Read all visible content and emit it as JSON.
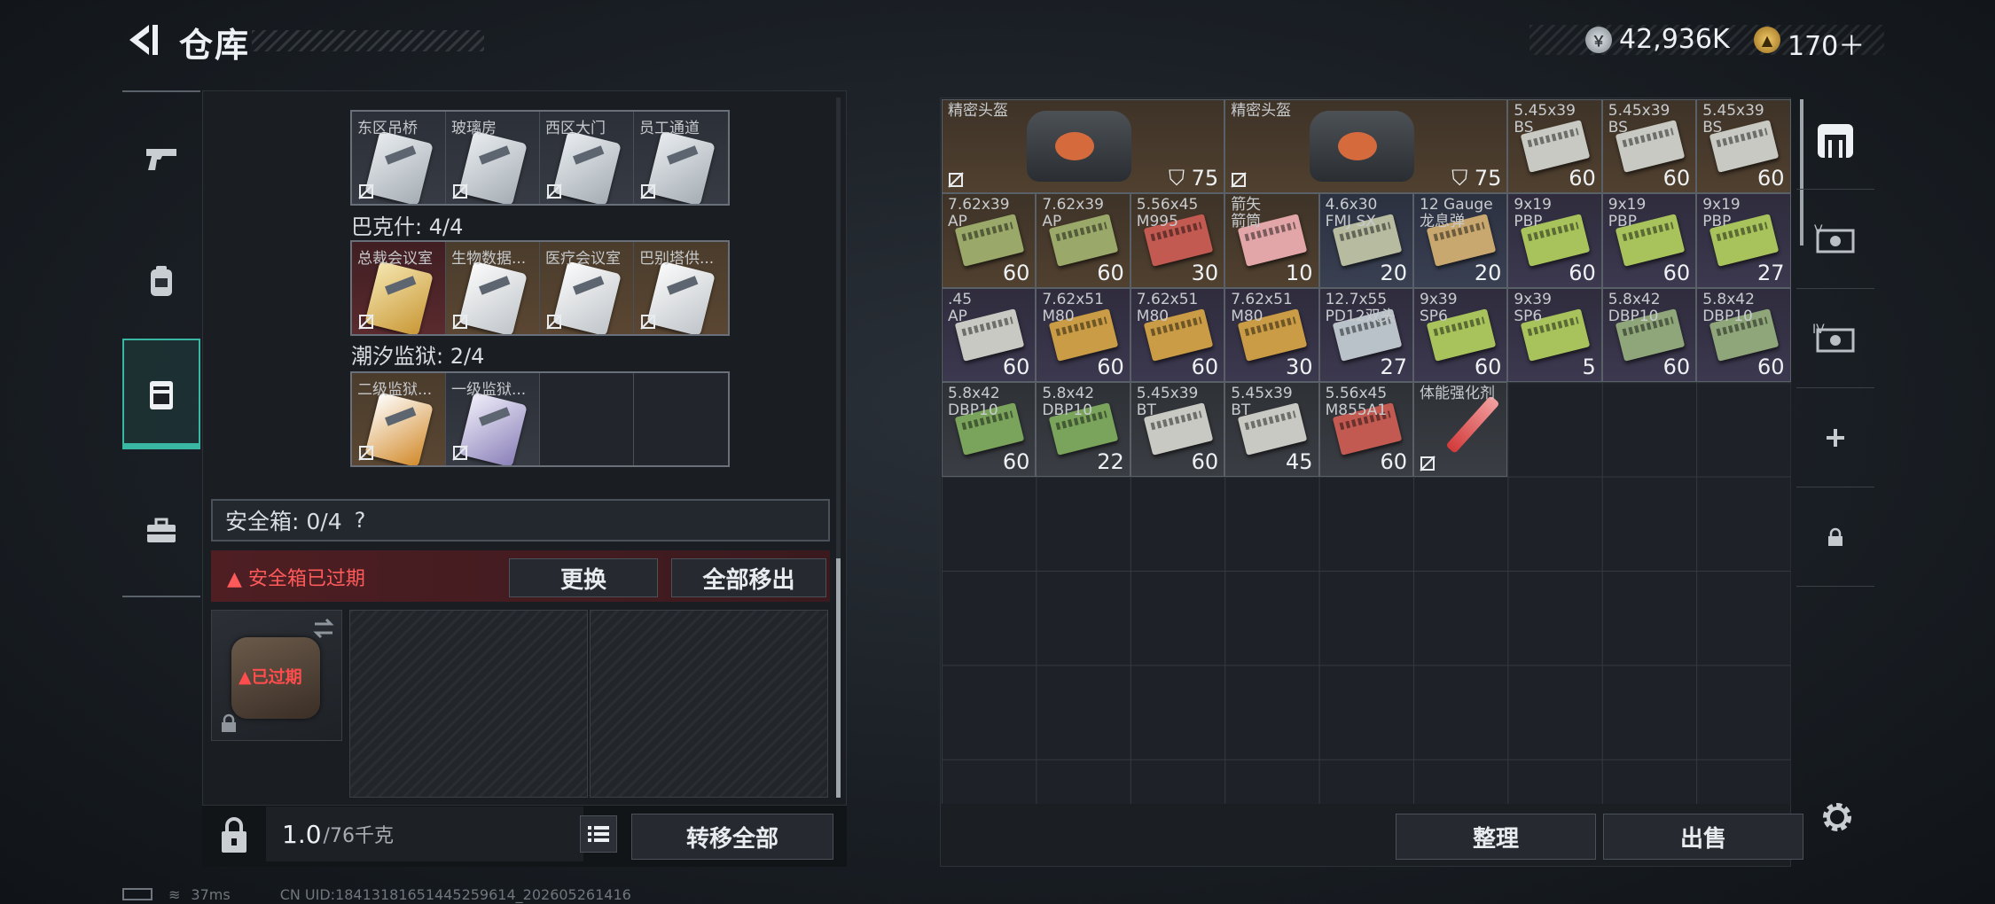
{
  "header": {
    "title": "仓库",
    "version": "",
    "currency": [
      {
        "name": "silver-coin-icon",
        "value": "42,936K"
      },
      {
        "name": "gold-coin-icon",
        "value": "170＋"
      }
    ]
  },
  "left_rail": {
    "items": [
      "pistol-icon",
      "backpack-icon",
      "locker-icon",
      "toolbox-icon"
    ],
    "active": "locker-icon"
  },
  "key_sections": [
    {
      "title": "",
      "cards": [
        {
          "label": "东区吊桥",
          "rarity": "plain"
        },
        {
          "label": "玻璃房",
          "rarity": "plain"
        },
        {
          "label": "西区大门",
          "rarity": "plain"
        },
        {
          "label": "员工通道",
          "rarity": "plain"
        }
      ]
    },
    {
      "title": "巴克什: 4/4",
      "cards": [
        {
          "label": "总裁会议室",
          "rarity": "red"
        },
        {
          "label": "生物数据...",
          "rarity": "gold"
        },
        {
          "label": "医疗会议室",
          "rarity": "gold"
        },
        {
          "label": "巴别塔供...",
          "rarity": "gold"
        }
      ]
    },
    {
      "title": "潮汐监狱: 2/4",
      "cards": [
        {
          "label": "二级监狱...",
          "rarity": "gold"
        },
        {
          "label": "一级监狱...",
          "rarity": "plain"
        },
        {
          "label": "",
          "rarity": "empty"
        },
        {
          "label": "",
          "rarity": "empty"
        }
      ]
    }
  ],
  "safe_box": {
    "label": "安全箱: 0/4",
    "help": "?",
    "expired_msg": "▲ 安全箱已过期",
    "replace_btn": "更换",
    "remove_all_btn": "全部移出",
    "case_status": "▲已过期"
  },
  "footer_left": {
    "weight": "1.0",
    "unit": "/76千克",
    "transfer_btn": "转移全部"
  },
  "stash": {
    "sort_btn": "整理",
    "sell_btn": "出售",
    "items": [
      {
        "name": "精密头盔",
        "count": "75",
        "kind": "helmet",
        "rarity": "gold",
        "col": 0,
        "row": 0,
        "w": 3,
        "h": 1,
        "armor": true
      },
      {
        "name": "精密头盔",
        "count": "75",
        "kind": "helmet",
        "rarity": "gold",
        "col": 3,
        "row": 0,
        "w": 3,
        "h": 1,
        "armor": true
      },
      {
        "name": "5.45x39\nBS",
        "count": "60",
        "kind": "ammo",
        "color": "#c8c9c2",
        "rarity": "gold",
        "col": 6,
        "row": 0
      },
      {
        "name": "5.45x39\nBS",
        "count": "60",
        "kind": "ammo",
        "color": "#c8c9c2",
        "rarity": "gold",
        "col": 7,
        "row": 0
      },
      {
        "name": "5.45x39\nBS",
        "count": "60",
        "kind": "ammo",
        "color": "#c8c9c2",
        "rarity": "gold",
        "col": 8,
        "row": 0
      },
      {
        "name": "7.62x39\nAP",
        "count": "60",
        "kind": "ammo",
        "color": "#9aa86a",
        "rarity": "gold",
        "col": 0,
        "row": 1
      },
      {
        "name": "7.62x39\nAP",
        "count": "60",
        "kind": "ammo",
        "color": "#9aa86a",
        "rarity": "gold",
        "col": 1,
        "row": 1
      },
      {
        "name": "5.56x45\nM995",
        "count": "30",
        "kind": "ammo",
        "color": "#c25a52",
        "rarity": "gold",
        "col": 2,
        "row": 1
      },
      {
        "name": "箭矢\n箭筒",
        "count": "10",
        "kind": "ammo",
        "color": "#e2a6a8",
        "rarity": "gold",
        "col": 3,
        "row": 1
      },
      {
        "name": "4.6x30\nFMJ SX",
        "count": "20",
        "kind": "ammo",
        "color": "#b7bba0",
        "rarity": "blue",
        "col": 4,
        "row": 1
      },
      {
        "name": "12 Gauge\n龙息弹",
        "count": "20",
        "kind": "ammo",
        "color": "#c9a870",
        "rarity": "blue",
        "col": 5,
        "row": 1
      },
      {
        "name": "9x19\nPBP",
        "count": "60",
        "kind": "ammo",
        "color": "#a8c35c",
        "rarity": "purple",
        "col": 6,
        "row": 1
      },
      {
        "name": "9x19\nPBP",
        "count": "60",
        "kind": "ammo",
        "color": "#a8c35c",
        "rarity": "purple",
        "col": 7,
        "row": 1
      },
      {
        "name": "9x19\nPBP",
        "count": "27",
        "kind": "ammo",
        "color": "#a8c35c",
        "rarity": "purple",
        "col": 8,
        "row": 1
      },
      {
        "name": ".45\nAP",
        "count": "60",
        "kind": "ammo",
        "color": "#c8c9c2",
        "rarity": "purple",
        "col": 0,
        "row": 2
      },
      {
        "name": "7.62x51\nM80",
        "count": "60",
        "kind": "ammo",
        "color": "#c99c45",
        "rarity": "purple",
        "col": 1,
        "row": 2
      },
      {
        "name": "7.62x51\nM80",
        "count": "60",
        "kind": "ammo",
        "color": "#c99c45",
        "rarity": "purple",
        "col": 2,
        "row": 2
      },
      {
        "name": "7.62x51\nM80",
        "count": "30",
        "kind": "ammo",
        "color": "#c99c45",
        "rarity": "purple",
        "col": 3,
        "row": 2
      },
      {
        "name": "12.7x55\nPD12双头",
        "count": "27",
        "kind": "ammo",
        "color": "#b9c2c8",
        "rarity": "purple",
        "col": 4,
        "row": 2
      },
      {
        "name": "9x39\nSP6",
        "count": "60",
        "kind": "ammo",
        "color": "#a8c35c",
        "rarity": "purple",
        "col": 5,
        "row": 2
      },
      {
        "name": "9x39\nSP6",
        "count": "5",
        "kind": "ammo",
        "color": "#a8c35c",
        "rarity": "purple",
        "col": 6,
        "row": 2
      },
      {
        "name": "5.8x42\nDBP10",
        "count": "60",
        "kind": "ammo",
        "color": "#8fa67a",
        "rarity": "purple",
        "col": 7,
        "row": 2
      },
      {
        "name": "5.8x42\nDBP10",
        "count": "60",
        "kind": "ammo",
        "color": "#8fa67a",
        "rarity": "purple",
        "col": 8,
        "row": 2
      },
      {
        "name": "5.8x42\nDBP10",
        "count": "60",
        "kind": "ammo",
        "color": "#7aa45c",
        "rarity": "white",
        "col": 0,
        "row": 3
      },
      {
        "name": "5.8x42\nDBP10",
        "count": "22",
        "kind": "ammo",
        "color": "#7aa45c",
        "rarity": "white",
        "col": 1,
        "row": 3
      },
      {
        "name": "5.45x39\nBT",
        "count": "60",
        "kind": "ammo",
        "color": "#c8c9c2",
        "rarity": "white",
        "col": 2,
        "row": 3
      },
      {
        "name": "5.45x39\nBT",
        "count": "45",
        "kind": "ammo",
        "color": "#c8c9c2",
        "rarity": "white",
        "col": 3,
        "row": 3
      },
      {
        "name": "5.56x45\nM855A1",
        "count": "60",
        "kind": "ammo",
        "color": "#c25a52",
        "rarity": "white",
        "col": 4,
        "row": 3
      },
      {
        "name": "体能强化剂",
        "count": "",
        "kind": "syringe",
        "rarity": "white",
        "col": 5,
        "row": 3,
        "nolink": true
      }
    ]
  },
  "right_rail": [
    "fence-icon",
    "ammo-box-icon",
    "ammo-box-iv-icon",
    "add-icon",
    "lock-icon"
  ],
  "status": {
    "ping": "37ms",
    "uid": "CN UID:18413181651445259614_202605261416"
  }
}
